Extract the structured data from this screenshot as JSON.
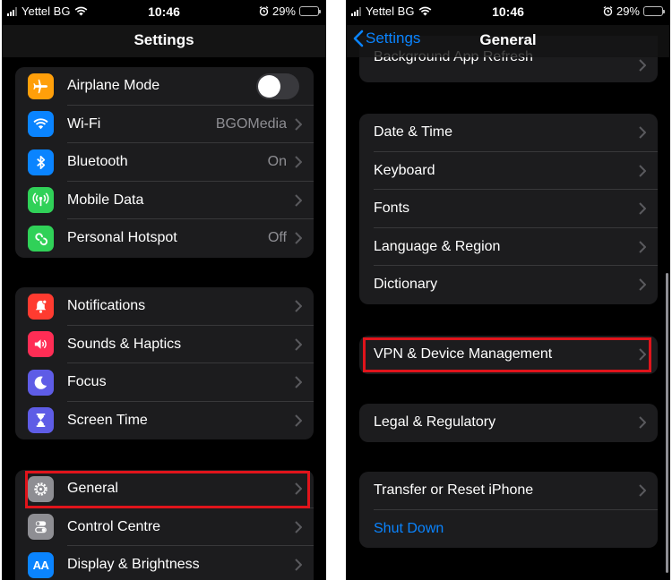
{
  "colors": {
    "accent": "#0a84ff",
    "highlight_box": "#e0141b",
    "airplane": "#ff9f0a",
    "wifi": "#0a84ff",
    "bluetooth": "#0a84ff",
    "mobile_data": "#30d158",
    "hotspot": "#30d158",
    "notifications": "#ff3b30",
    "sounds": "#ff2d55",
    "focus": "#5e5ce6",
    "screen_time": "#5e5ce6",
    "general": "#8e8e93",
    "control_centre": "#8e8e93",
    "display": "#0a84ff"
  },
  "left": {
    "status": {
      "carrier": "Yettel BG",
      "time": "10:46",
      "battery": "29%"
    },
    "title": "Settings",
    "groups": [
      [
        {
          "label": "Airplane Mode",
          "icon": "airplane-icon",
          "toggle": "off"
        },
        {
          "label": "Wi-Fi",
          "icon": "wifi-icon",
          "value": "BGOMedia"
        },
        {
          "label": "Bluetooth",
          "icon": "bluetooth-icon",
          "value": "On"
        },
        {
          "label": "Mobile Data",
          "icon": "antenna-icon",
          "value": ""
        },
        {
          "label": "Personal Hotspot",
          "icon": "hotspot-icon",
          "value": "Off"
        }
      ],
      [
        {
          "label": "Notifications",
          "icon": "bell-icon"
        },
        {
          "label": "Sounds & Haptics",
          "icon": "speaker-icon"
        },
        {
          "label": "Focus",
          "icon": "moon-icon"
        },
        {
          "label": "Screen Time",
          "icon": "hourglass-icon"
        }
      ],
      [
        {
          "label": "General",
          "icon": "gear-icon"
        },
        {
          "label": "Control Centre",
          "icon": "switches-icon"
        },
        {
          "label": "Display & Brightness",
          "icon": "text-size-icon",
          "icon_text": "AA"
        }
      ]
    ]
  },
  "right": {
    "status": {
      "carrier": "Yettel BG",
      "time": "10:46",
      "battery": "29%"
    },
    "back_label": "Settings",
    "title": "General",
    "groups": [
      [
        {
          "label": "Background App Refresh"
        }
      ],
      [
        {
          "label": "Date & Time"
        },
        {
          "label": "Keyboard"
        },
        {
          "label": "Fonts"
        },
        {
          "label": "Language & Region"
        },
        {
          "label": "Dictionary"
        }
      ],
      [
        {
          "label": "VPN & Device Management"
        }
      ],
      [
        {
          "label": "Legal & Regulatory"
        }
      ],
      [
        {
          "label": "Transfer or Reset iPhone"
        },
        {
          "label": "Shut Down"
        }
      ]
    ]
  }
}
